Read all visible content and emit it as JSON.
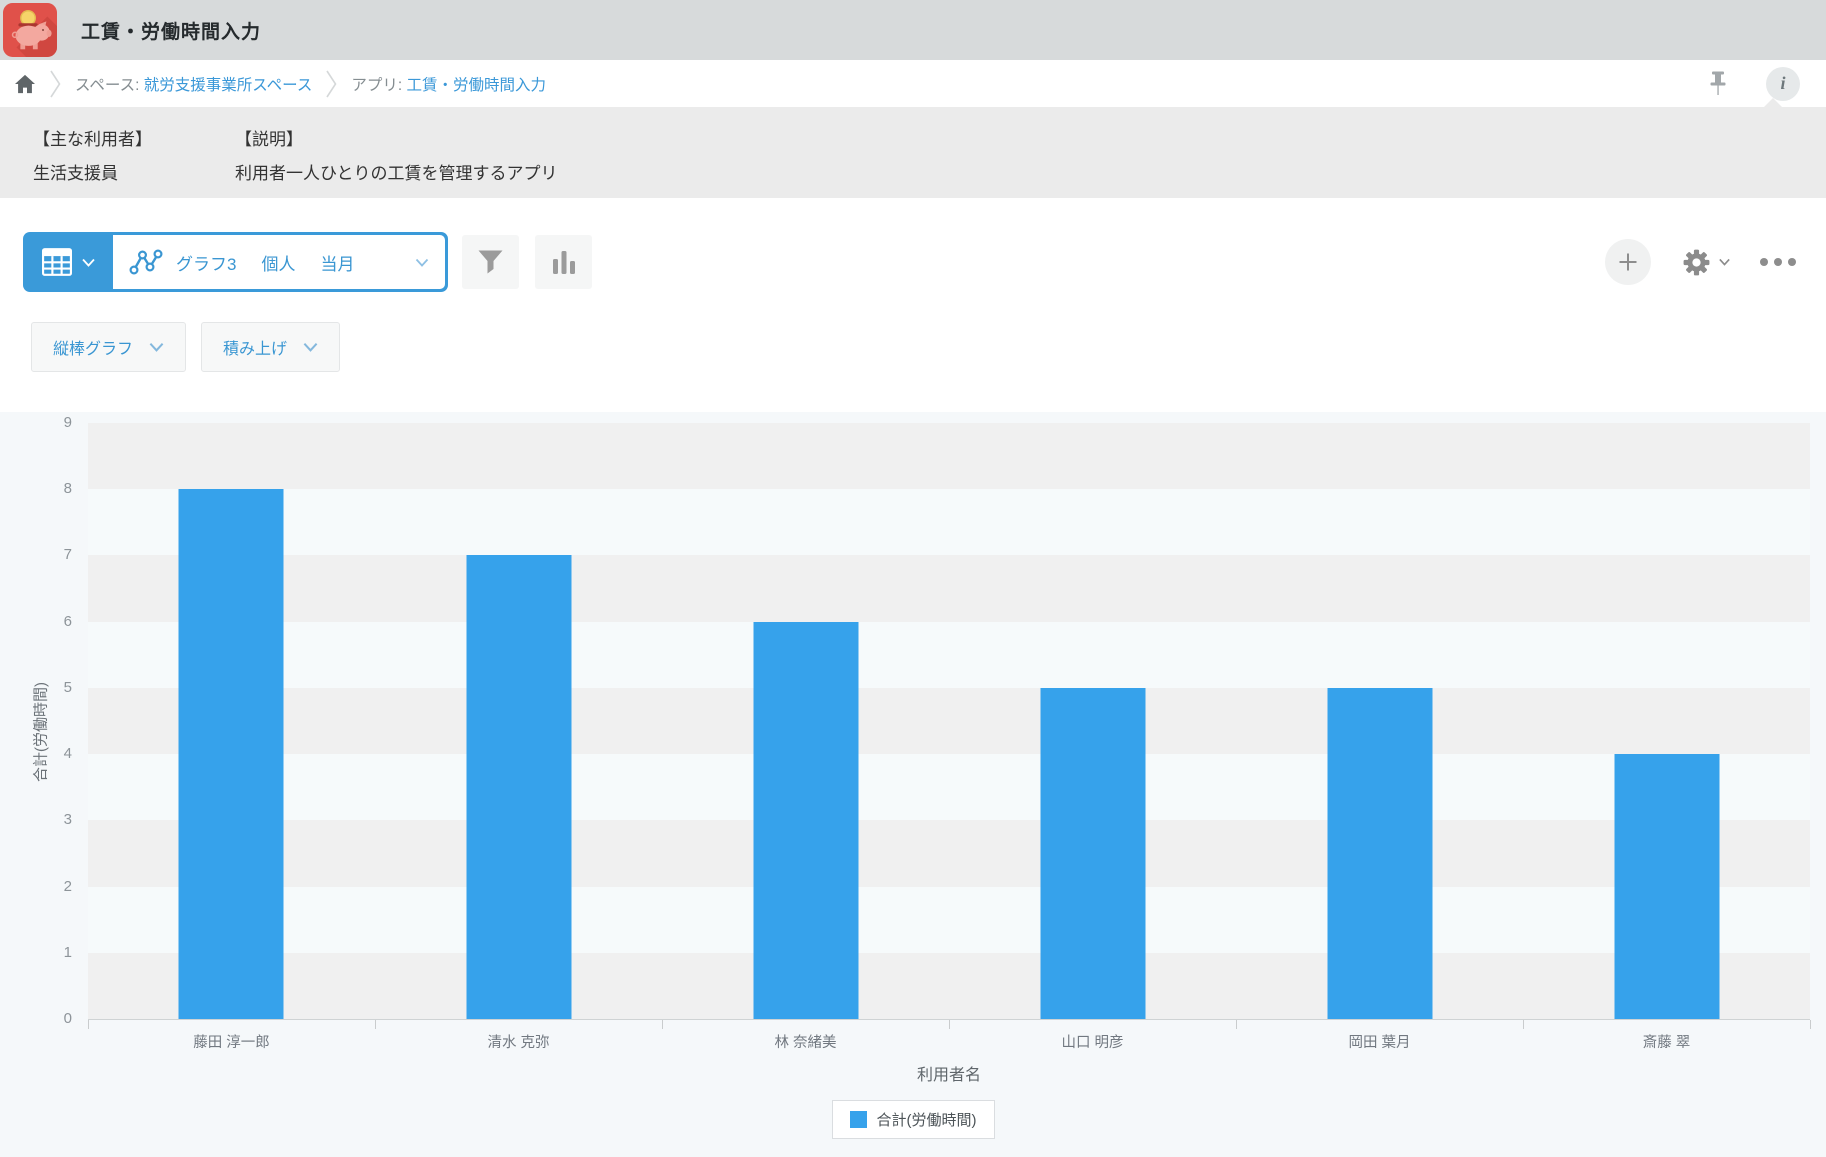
{
  "header": {
    "title": "工賃・労働時間入力",
    "icon": "piggy-bank-app-icon"
  },
  "breadcrumb": {
    "space_label": "スペース:",
    "space_link": "就労支援事業所スペース",
    "app_label": "アプリ:",
    "app_link": "工賃・労働時間入力",
    "icons": [
      "home-icon",
      "pin-icon",
      "info-icon"
    ]
  },
  "info_panel": {
    "users_heading": "【主な利用者】",
    "users_value": "生活支援員",
    "desc_heading": "【説明】",
    "desc_value": "利用者一人ひとりの工賃を管理するアプリ"
  },
  "toolbar": {
    "view_switcher_icons": [
      "table-grid-icon",
      "chevron-down-icon"
    ],
    "graph_selector": {
      "icon": "line-chart-icon",
      "name": "グラフ3",
      "tags": [
        "個人",
        "当月"
      ]
    },
    "filter_icon": "funnel-icon",
    "chart_button_icon": "bar-chart-icon",
    "right_icons": [
      "plus-icon",
      "gear-icon",
      "ellipsis-icon"
    ]
  },
  "chart_controls": {
    "type_label": "縦棒グラフ",
    "stack_label": "積み上げ"
  },
  "colors": {
    "accent_blue": "#3a9ad9",
    "link_blue": "#3b98d8"
  },
  "chart_data": {
    "type": "bar",
    "categories": [
      "藤田 淳一郎",
      "清水 克弥",
      "林 奈緒美",
      "山口 明彦",
      "岡田 葉月",
      "斎藤 翠"
    ],
    "values": [
      8,
      7,
      6,
      5,
      5,
      4
    ],
    "series_name": "合計(労働時間)",
    "xlabel": "利用者名",
    "ylabel": "合計(労働時間)",
    "ylim": [
      0,
      9
    ],
    "yticks": [
      0,
      1,
      2,
      3,
      4,
      5,
      6,
      7,
      8,
      9
    ],
    "bar_color": "#36a2eb",
    "band_color_even": "#f0f0f0",
    "band_color_odd": "#f6fafb",
    "grid": "horizontal-bands",
    "legend_position": "bottom",
    "legend": [
      "合計(労働時間)"
    ]
  }
}
